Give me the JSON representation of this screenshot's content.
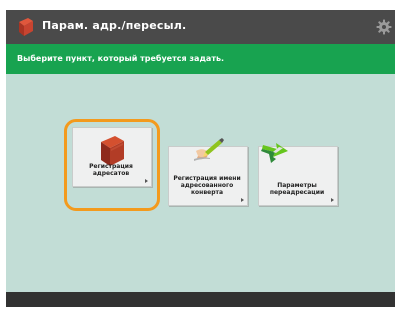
{
  "titlebar": {
    "title": "Парам. адр./пересыл.",
    "app_icon": "book-icon",
    "settings_icon": "gear-icon"
  },
  "instruction": {
    "text": "Выберите пункт, который требуется задать."
  },
  "tiles": [
    {
      "label": "Регистрация адресатов",
      "icon": "address-book-icon",
      "selected": true
    },
    {
      "label": "Регистрация имени адресованного конверта",
      "icon": "pen-write-icon",
      "selected": false
    },
    {
      "label": "Параметры переадресации",
      "icon": "forward-arrow-icon",
      "selected": false
    }
  ],
  "colors": {
    "header": "#4a4a4a",
    "accent_green": "#18a350",
    "content_bg": "#c2ddd6",
    "selection": "#f39a1d"
  }
}
